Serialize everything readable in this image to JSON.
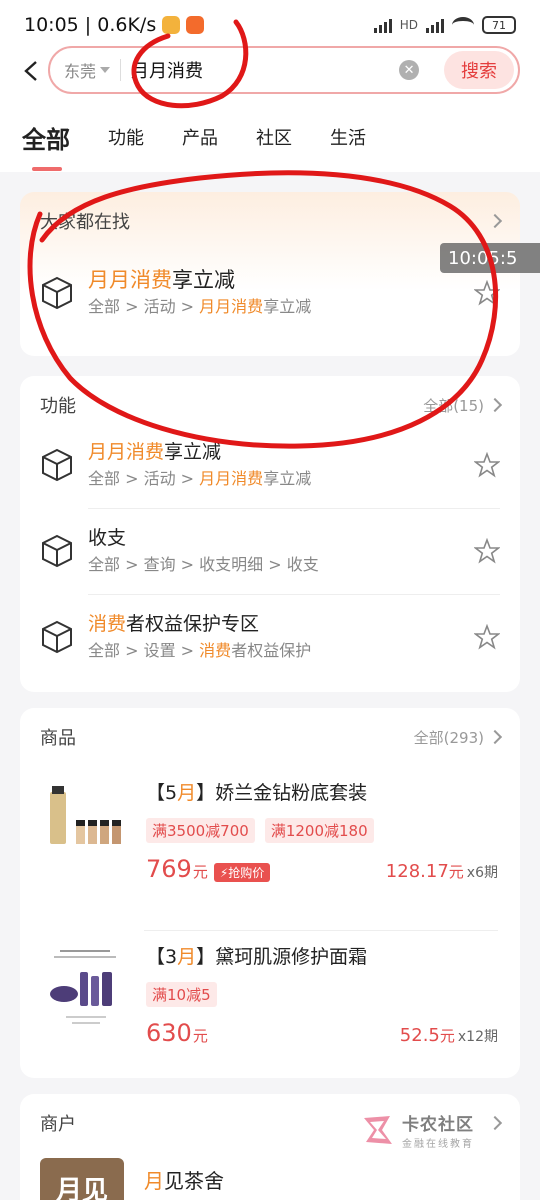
{
  "status_bar": {
    "time_speed": "10:05 | 0.6K/s",
    "battery": "71",
    "network": "HD"
  },
  "search": {
    "city": "东莞",
    "query": "月月消费",
    "button_label": "搜索"
  },
  "tabs": [
    "全部",
    "功能",
    "产品",
    "社区",
    "生活"
  ],
  "hot": {
    "title": "大家都在找",
    "item": {
      "title_hl": "月月消费",
      "title_rest": "享立减",
      "path_pre": "全部 > 活动 > ",
      "path_hl": "月月消费",
      "path_post": "享立减"
    }
  },
  "overlay_time": "10:05:5",
  "functions": {
    "title": "功能",
    "more": "全部(15)",
    "items": [
      {
        "title_hl": "月月消费",
        "title_rest": "享立减",
        "path_pre": "全部 > 活动 > ",
        "path_hl": "月月消费",
        "path_post": "享立减"
      },
      {
        "title_hl": "",
        "title_rest": "收支",
        "path_pre": "全部 > 查询 > 收支明细 > 收支",
        "path_hl": "",
        "path_post": ""
      },
      {
        "title_hl": "消费",
        "title_rest": "者权益保护专区",
        "path_pre": "全部 > 设置 > ",
        "path_hl": "消费",
        "path_post": "者权益保护"
      }
    ]
  },
  "goods": {
    "title": "商品",
    "more": "全部(293)",
    "items": [
      {
        "title_pre": "【5",
        "title_hl": "月",
        "title_post": "】娇兰金钻粉底套装",
        "tags": [
          "满3500减700",
          "满1200减180"
        ],
        "price": "769",
        "yuan": "元",
        "flash": "抢购价",
        "installment_amount": "128.17",
        "installment_yuan": "元",
        "installment_term": "x6期"
      },
      {
        "title_pre": "【3",
        "title_hl": "月",
        "title_post": "】黛珂肌源修护面霜",
        "tags": [
          "满10减5"
        ],
        "price": "630",
        "yuan": "元",
        "flash": "",
        "installment_amount": "52.5",
        "installment_yuan": "元",
        "installment_term": "x12期"
      }
    ]
  },
  "merchant": {
    "title": "商户",
    "logo_text": "月见",
    "name_hl": "月",
    "name_rest": "见茶舍"
  },
  "watermark": {
    "title": "卡农社区",
    "sub": "金融在线教育"
  },
  "colors": {
    "accent": "#f08a2a",
    "price_red": "#e24c4c",
    "annotation_red": "#e01818"
  }
}
